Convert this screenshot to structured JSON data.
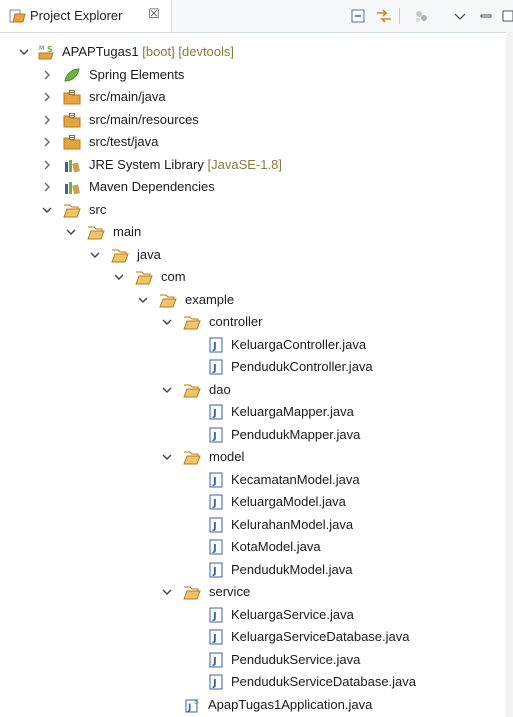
{
  "tab": {
    "title": "Project Explorer",
    "close": "☒"
  },
  "toolbar": {
    "icons": [
      "collapse-all-icon",
      "link-with-editor-icon",
      "filters-icon",
      "view-menu-icon",
      "minimize-icon",
      "maximize-icon"
    ]
  },
  "tree": {
    "project": {
      "label": "APAPTugas1",
      "decoration": "[boot] [devtools]"
    },
    "spring": {
      "label": "Spring Elements"
    },
    "src_main_java": {
      "label": "src/main/java"
    },
    "src_main_resources": {
      "label": "src/main/resources"
    },
    "src_test_java": {
      "label": "src/test/java"
    },
    "jre": {
      "label": "JRE System Library",
      "decoration": "[JavaSE-1.8]"
    },
    "maven": {
      "label": "Maven Dependencies"
    },
    "src": {
      "label": "src"
    },
    "main": {
      "label": "main"
    },
    "java": {
      "label": "java"
    },
    "com": {
      "label": "com"
    },
    "example": {
      "label": "example"
    },
    "controller": {
      "label": "controller"
    },
    "controller_files": [
      "KeluargaController.java",
      "PendudukController.java"
    ],
    "dao": {
      "label": "dao"
    },
    "dao_files": [
      "KeluargaMapper.java",
      "PendudukMapper.java"
    ],
    "model": {
      "label": "model"
    },
    "model_files": [
      "KecamatanModel.java",
      "KeluargaModel.java",
      "KelurahanModel.java",
      "KotaModel.java",
      "PendudukModel.java"
    ],
    "service": {
      "label": "service"
    },
    "service_files": [
      "KeluargaService.java",
      "KeluargaServiceDatabase.java",
      "PendudukService.java",
      "PendudukServiceDatabase.java"
    ],
    "app": {
      "label": "ApapTugas1Application.java"
    }
  },
  "colors": {
    "folder": "#e8a33c",
    "package": "#c78a2c",
    "java_file": "#3b5fa8",
    "spring_leaf": "#6db33f",
    "decoration": "#8a7a3e"
  }
}
